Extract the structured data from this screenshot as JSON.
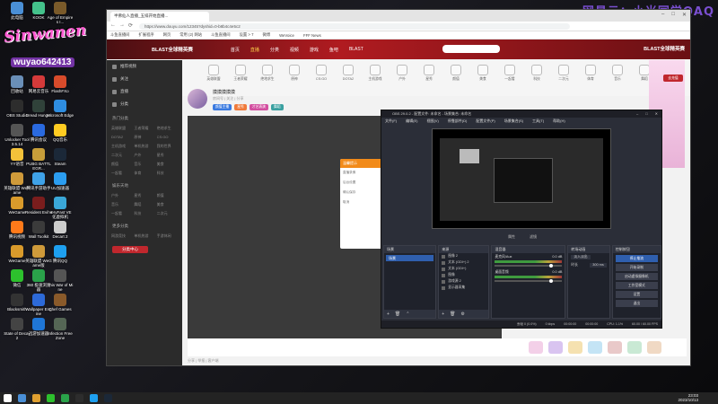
{
  "desktop": {
    "watermark": "网易云：小米同学QAQ",
    "brand_art": "Sinwanen",
    "brand_uid": "wuyao642413",
    "icons": [
      {
        "label": "此电脑",
        "color": "#4a8fd6"
      },
      {
        "label": "KOOK",
        "color": "#44c28b"
      },
      {
        "label": "Age of Empires I...",
        "color": "#7a5a2a"
      },
      {
        "label": "回收站",
        "color": "#6a8fb8"
      },
      {
        "label": "网易云音乐",
        "color": "#d53a3a"
      },
      {
        "label": "FlashFXo",
        "color": "#d84b2b"
      },
      {
        "label": "OBS Studio",
        "color": "#2d2d2d"
      },
      {
        "label": "Dread Hunger",
        "color": "#30423a"
      },
      {
        "label": "Microsoft Edge",
        "color": "#2e8de0"
      },
      {
        "label": "Unlocker Tool 3.5.14",
        "color": "#555555"
      },
      {
        "label": "腾讯会议",
        "color": "#2a6ae0"
      },
      {
        "label": "QQ音乐",
        "color": "#ffcc22"
      },
      {
        "label": "YY语音",
        "color": "#f4c23a"
      },
      {
        "label": "PUBG BATTLEGR...",
        "color": "#c79e3a"
      },
      {
        "label": "Steam",
        "color": "#1b2838"
      },
      {
        "label": "英雄联盟 WeGame",
        "color": "#cf9a3a"
      },
      {
        "label": "腾讯手游助手",
        "color": "#3fa2e8"
      },
      {
        "label": "UU加速器",
        "color": "#2b9df0"
      },
      {
        "label": "WeGame",
        "color": "#d99a2b"
      },
      {
        "label": "Resident Evil 4",
        "color": "#7a1d1d"
      },
      {
        "label": "VeryFast VE 化虚拟机",
        "color": "#3aa7d8"
      },
      {
        "label": "腾讯视频",
        "color": "#ff7a1a"
      },
      {
        "label": "Wall Toolkit",
        "color": "#3b3b3b"
      },
      {
        "label": "Decart 2",
        "color": "#cccccc"
      },
      {
        "label": "WeGame",
        "color": "#d99a2b"
      },
      {
        "label": "英雄联盟 WeGame版",
        "color": "#cf9a3a"
      },
      {
        "label": "腾讯QQ",
        "color": "#1ea0f0"
      },
      {
        "label": "微信",
        "color": "#2dc12d"
      },
      {
        "label": "360 极速浏览器",
        "color": "#2aa34a"
      },
      {
        "label": "This War of Mine",
        "color": "#555555"
      },
      {
        "label": "Blacksmith",
        "color": "#333333"
      },
      {
        "label": "Wallpaper Engine",
        "color": "#2d6ad8"
      },
      {
        "label": "Chef Games",
        "color": "#8a5a2a"
      },
      {
        "label": "State of Decay 2",
        "color": "#444444"
      },
      {
        "label": "迅游加速器",
        "color": "#1f76d6"
      },
      {
        "label": "Infection Free Zone",
        "color": "#556655"
      }
    ]
  },
  "taskbar": {
    "time": "23:03",
    "date": "2023/10/13",
    "icons": [
      "#ffffff",
      "#4a8fd6",
      "#e0a030",
      "#2dc12d",
      "#2aa34a",
      "#2d2d2d",
      "#1ea0f0",
      "#1b2838"
    ]
  },
  "browser": {
    "tab_title": "半佛仙人直播_五排开始直播...",
    "url": "https://www.douyu.com/12345?dyshid=0-b8b4c4e5c2",
    "bookmarks": [
      "斗鱼直播间",
      "扩展程序",
      "网页",
      "常用 (2) 网站",
      "斗鱼直播间",
      "设置 > 7",
      "微博",
      "WeVoice",
      "FFF News"
    ],
    "nav": [
      "首页",
      "直播",
      "分类",
      "视频",
      "游戏",
      "鱼吧",
      "BLAST"
    ],
    "active_nav": "直播",
    "blast_left": "BLAST全球精英赛",
    "blast_right": "BLAST全球精英赛",
    "categories": [
      "英雄联盟",
      "王者荣耀",
      "绝地求生",
      "原神",
      "CS:GO",
      "DOTA2",
      "主机游戏",
      "户外",
      "星秀",
      "颜值",
      "美食",
      "一起看",
      "科技",
      "二次元",
      "体育",
      "音乐",
      "舞蹈"
    ],
    "sidebar": {
      "top_items": [
        "推荐视频",
        "关注",
        "直播",
        "分类"
      ],
      "section1": "热门分类",
      "grid1": [
        "英雄联盟",
        "王者荣耀",
        "绝地求生",
        "DOTA2",
        "原神",
        "CS:GO",
        "主机游戏",
        "单机热游",
        "我的世界",
        "二次元",
        "户外",
        "星秀",
        "颜值",
        "音乐",
        "美食",
        "一起看",
        "体育",
        "科技"
      ],
      "section2": "娱乐天地",
      "grid2": [
        "户外",
        "星秀",
        "颜值",
        "音乐",
        "舞蹈",
        "美食",
        "一起看",
        "科技",
        "二次元"
      ],
      "section3": "更多分类",
      "grid3": [
        "网游竞技",
        "单机热游",
        "手游休闲"
      ],
      "button": "分类中心"
    },
    "room": {
      "title": "摸摸摸摸摸",
      "sub": "房间号 | 关注 | 分享",
      "tags": [
        {
          "text": "颜值主播",
          "color": "#3a7ae0"
        },
        {
          "text": "星秀",
          "color": "#f07a3a"
        },
        {
          "text": "才艺表演",
          "color": "#d34fa0"
        },
        {
          "text": "舞蹈",
          "color": "#3aa0a0"
        }
      ]
    },
    "dialog": {
      "title": "温馨提示",
      "rows": [
        "直播录像",
        "后台设置",
        "确认保存",
        "取消"
      ]
    },
    "promo_badge": "去充值",
    "share_text": "分享 | 举报 | 客户端",
    "gifts": [
      "#f3d0e8",
      "#d9c4f0",
      "#f5e1b0",
      "#c4e4f5",
      "#e9c9c9",
      "#c9e9d4",
      "#f0d9c4"
    ]
  },
  "obs": {
    "title": "OBS 29.0.2 - 配置文件: 未命名 - 场景集合: 未命名",
    "menu": [
      "文件(F)",
      "编辑(E)",
      "视图(V)",
      "停靠部件(D)",
      "配置文件(P)",
      "场景集合(S)",
      "工具(T)",
      "帮助(H)"
    ],
    "scene_label": "未选择源",
    "scene_tabs": [
      "属性",
      "滤镜"
    ],
    "docks": {
      "scenes": {
        "title": "场景",
        "items": [
          "场景"
        ]
      },
      "sources": {
        "title": "来源",
        "items": [
          "图像 2",
          "文本 (GDI+) 2",
          "文本 (GDI+)",
          "图像",
          "游戏源 2",
          "显示器采集"
        ]
      },
      "mixer": {
        "title": "混音器",
        "rows": [
          {
            "name": "麦克风/Aux",
            "db": "0.0 dB"
          },
          {
            "name": "桌面音频",
            "db": "0.0 dB"
          }
        ]
      },
      "transitions": {
        "title": "转场动画",
        "type": "淡入淡出",
        "duration_label": "时长",
        "duration": "300 ms"
      },
      "controls": {
        "title": "控制按钮",
        "buttons": [
          "停止推流",
          "开始录制",
          "启动虚拟摄像机",
          "工作室模式",
          "设置",
          "退出"
        ]
      }
    },
    "status": [
      "丢帧 0 (0.0%)",
      "0 kbps",
      "00:00:00",
      "00:00:00",
      "CPU: 1.1%",
      "60.00 / 60.00 FPS"
    ]
  }
}
